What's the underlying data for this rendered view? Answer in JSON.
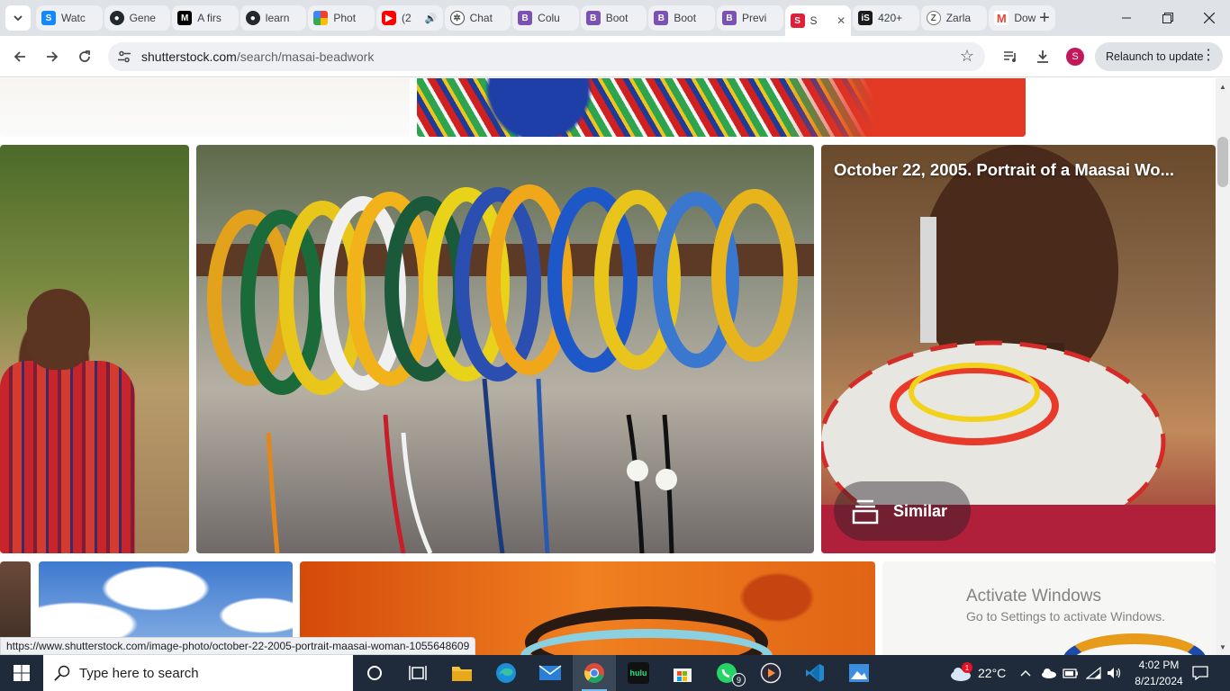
{
  "browser": {
    "tabs": [
      {
        "label": "Watc",
        "icon": "stackblitz-icon",
        "color": "#1389fd"
      },
      {
        "label": "Gene",
        "icon": "github-icon",
        "color": "#24292f"
      },
      {
        "label": "A firs",
        "icon": "medium-icon",
        "color": "#000000"
      },
      {
        "label": "learn",
        "icon": "github-icon",
        "color": "#24292f"
      },
      {
        "label": "Phot",
        "icon": "google-photos-icon",
        "color": "#ea4335"
      },
      {
        "label": "(2",
        "icon": "youtube-icon",
        "color": "#ff0000"
      },
      {
        "label": "Chat",
        "icon": "chatgpt-icon",
        "color": "#444444"
      },
      {
        "label": "Colu",
        "icon": "bootstrap-icon",
        "color": "#7952b3"
      },
      {
        "label": "Boot",
        "icon": "bootstrap-icon",
        "color": "#7952b3"
      },
      {
        "label": "Boot",
        "icon": "bootstrap-icon",
        "color": "#7952b3"
      },
      {
        "label": "Previ",
        "icon": "bootstrap-icon",
        "color": "#7952b3"
      },
      {
        "label": "S",
        "icon": "shutterstock-icon",
        "color": "#e01e38",
        "active": true
      },
      {
        "label": "420+",
        "icon": "istock-icon",
        "color": "#1b1b1b"
      },
      {
        "label": "Zarla",
        "icon": "zarla-icon",
        "color": "#555555"
      },
      {
        "label": "Dow",
        "icon": "gmail-icon",
        "color": "#ea4335"
      }
    ],
    "url_domain": "shutterstock.com",
    "url_path": "/search/masai-beadwork",
    "relaunch_label": "Relaunch to update",
    "profile_initial": "S"
  },
  "page": {
    "overlay_title": "October 22, 2005. Portrait of a Maasai Wo...",
    "similar_label": "Similar",
    "status_url": "https://www.shutterstock.com/image-photo/october-22-2005-portrait-maasai-woman-1055648609"
  },
  "watermark": {
    "line1": "Activate Windows",
    "line2": "Go to Settings to activate Windows."
  },
  "taskbar": {
    "search_placeholder": "Type here to search",
    "whatsapp_badge": "9",
    "weather_badge": "1",
    "temperature": "22°C",
    "time": "4:02 PM",
    "date": "8/21/2024"
  }
}
